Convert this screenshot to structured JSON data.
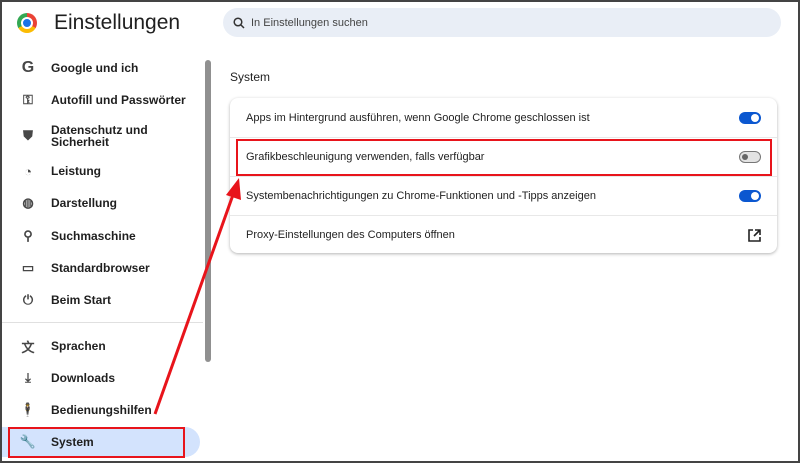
{
  "header": {
    "title": "Einstellungen",
    "search_placeholder": "In Einstellungen suchen"
  },
  "sidebar": {
    "items": [
      {
        "label": "Google und ich",
        "icon": "google-icon"
      },
      {
        "label": "Autofill und Passwörter",
        "icon": "key-icon"
      },
      {
        "label": "Datenschutz und Sicherheit",
        "icon": "shield-icon"
      },
      {
        "label": "Leistung",
        "icon": "speedometer-icon"
      },
      {
        "label": "Darstellung",
        "icon": "palette-icon"
      },
      {
        "label": "Suchmaschine",
        "icon": "search-icon"
      },
      {
        "label": "Standardbrowser",
        "icon": "browser-icon"
      },
      {
        "label": "Beim Start",
        "icon": "power-icon"
      },
      {
        "label": "Sprachen",
        "icon": "translate-icon"
      },
      {
        "label": "Downloads",
        "icon": "download-icon"
      },
      {
        "label": "Bedienungshilfen",
        "icon": "accessibility-icon"
      },
      {
        "label": "System",
        "icon": "wrench-icon",
        "selected": true
      }
    ]
  },
  "main": {
    "section_title": "System",
    "rows": [
      {
        "label": "Apps im Hintergrund ausführen, wenn Google Chrome geschlossen ist",
        "toggle": true
      },
      {
        "label": "Grafikbeschleunigung verwenden, falls verfügbar",
        "toggle": false
      },
      {
        "label": "Systembenachrichtigungen zu Chrome-Funktionen und -Tipps anzeigen",
        "toggle": true
      },
      {
        "label": "Proxy-Einstellungen des Computers öffnen",
        "action": "external-link-icon"
      }
    ]
  },
  "colors": {
    "accent": "#0b57d0",
    "selected_bg": "#d3e3fd",
    "annotation": "#e8141b"
  }
}
